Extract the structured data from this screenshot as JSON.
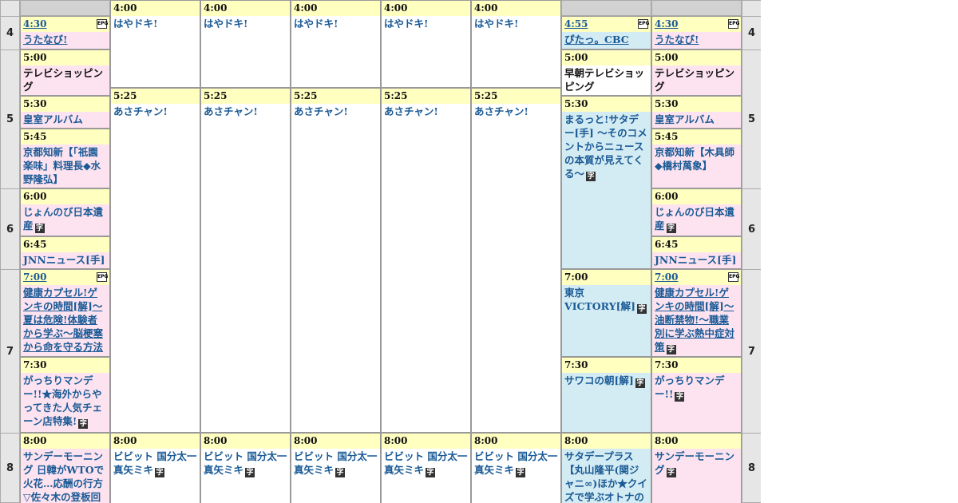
{
  "hours": [
    "4",
    "5",
    "6",
    "7",
    "8"
  ],
  "channels": [
    {
      "id": "ch1",
      "programs": [
        {
          "time": "4:30",
          "title": "うたなび!",
          "link": true,
          "epg": true,
          "caption": false
        },
        {
          "time": "5:00",
          "title": "テレビショッピング",
          "caption": false,
          "dark": true
        },
        {
          "time": "5:30",
          "title": "皇室アルバム",
          "caption": false
        },
        {
          "time": "5:45",
          "title": "京都知新【「祇園楽味」料理長◆水野隆弘】",
          "caption": false
        },
        {
          "time": "6:00",
          "title": "じょんのび日本遺産",
          "caption": true
        },
        {
          "time": "6:45",
          "title": "JNNニュース[手]",
          "caption": false
        },
        {
          "time": "7:00",
          "title": "健康カプセル!ゲンキの時間[解]～夏は危険!体験者から学ぶ～脳梗塞から命を守る方法",
          "link": true,
          "epg": true,
          "caption": true
        },
        {
          "time": "7:30",
          "title": "がっちりマンデー!!★海外からやってきた人気チェーン店特集!",
          "caption": true
        },
        {
          "time": "8:00",
          "title": "サンデーモーニング 日韓がWTOで火花…応酬の行方▽佐々木の登板回避",
          "caption": false
        }
      ]
    },
    {
      "id": "ch2",
      "programs": [
        {
          "time": "4:00",
          "title": "はやドキ!",
          "caption": false
        },
        {
          "time": "5:25",
          "title": "あさチャン!",
          "caption": false
        },
        {
          "time": "8:00",
          "title": "ビビット 国分太一 真矢ミキ",
          "caption": true
        }
      ]
    },
    {
      "id": "ch3",
      "programs": [
        {
          "time": "4:00",
          "title": "はやドキ!",
          "caption": false
        },
        {
          "time": "5:25",
          "title": "あさチャン!",
          "caption": false
        },
        {
          "time": "8:00",
          "title": "ビビット 国分太一 真矢ミキ",
          "caption": true
        }
      ]
    },
    {
      "id": "ch4",
      "programs": [
        {
          "time": "4:00",
          "title": "はやドキ!",
          "caption": false
        },
        {
          "time": "5:25",
          "title": "あさチャン!",
          "caption": false
        },
        {
          "time": "8:00",
          "title": "ビビット 国分太一 真矢ミキ",
          "caption": true
        }
      ]
    },
    {
      "id": "ch5",
      "programs": [
        {
          "time": "4:00",
          "title": "はやドキ!",
          "caption": false
        },
        {
          "time": "5:25",
          "title": "あさチャン!",
          "caption": false
        },
        {
          "time": "8:00",
          "title": "ビビット 国分太一 真矢ミキ",
          "caption": true
        }
      ]
    },
    {
      "id": "ch6",
      "programs": [
        {
          "time": "4:00",
          "title": "はやドキ!",
          "caption": false
        },
        {
          "time": "5:25",
          "title": "あさチャン!",
          "caption": false
        },
        {
          "time": "8:00",
          "title": "ビビット 国分太一 真矢ミキ",
          "caption": true
        }
      ]
    },
    {
      "id": "ch7",
      "programs": [
        {
          "time": "4:55",
          "title": "ぴたっ。CBC",
          "link": true,
          "epg": true,
          "caption": false
        },
        {
          "time": "5:00",
          "title": "早朝テレビショッピング",
          "caption": false,
          "dark": true
        },
        {
          "time": "5:30",
          "title": "まるっと!サタデー[手] ～そのコメントからニュースの本質が見えてくる～",
          "caption": true
        },
        {
          "time": "7:00",
          "title": "東京VICTORY[解]",
          "caption": true
        },
        {
          "time": "7:30",
          "title": "サワコの朝[解]",
          "caption": true
        },
        {
          "time": "8:00",
          "title": "サタデープラス【丸山隆平(関ジャニ∞)ほか★クイズで学ぶオトナの週",
          "caption": false
        }
      ]
    },
    {
      "id": "ch8",
      "programs": [
        {
          "time": "4:30",
          "title": "うたなび!",
          "link": true,
          "epg": true,
          "caption": false
        },
        {
          "time": "5:00",
          "title": "テレビショッピング",
          "caption": false,
          "dark": true
        },
        {
          "time": "5:30",
          "title": "皇室アルバム",
          "caption": false
        },
        {
          "time": "5:45",
          "title": "京都知新【木具師◆橋村萬象】",
          "caption": false
        },
        {
          "time": "6:00",
          "title": "じょんのび日本遺産",
          "caption": true
        },
        {
          "time": "6:45",
          "title": "JNNニュース[手]",
          "caption": false
        },
        {
          "time": "7:00",
          "title": "健康カプセル!ゲンキの時間[解]～油断禁物!～職業別に学ぶ熱中症対策",
          "link": true,
          "epg": true,
          "caption": true
        },
        {
          "time": "7:30",
          "title": "がっちりマンデー!!",
          "caption": true
        },
        {
          "time": "8:00",
          "title": "サンデーモーニング",
          "caption": true
        }
      ]
    }
  ],
  "icons": {
    "epg": "EPG",
    "caption": "字"
  },
  "colors": {
    "time_bar": "#ffffc0",
    "pink": "#fde3ef",
    "blue": "#d3ebf2",
    "link": "#1a5a96",
    "hour_bg": "#e6e6e6"
  }
}
